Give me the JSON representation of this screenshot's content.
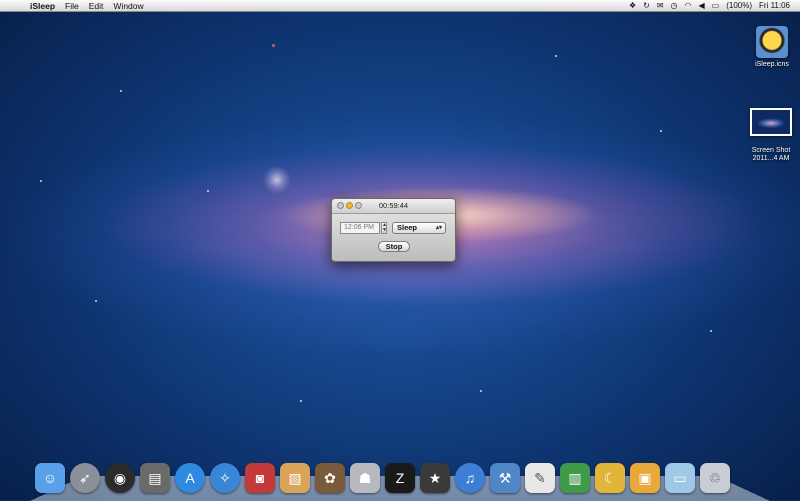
{
  "menubar": {
    "apple_glyph": "",
    "app_name": "iSleep",
    "items": [
      "File",
      "Edit",
      "Window"
    ],
    "battery": "(100%)",
    "clock": "Fri 11:06"
  },
  "desktop_icons": [
    {
      "label": "iSleep.icns"
    },
    {
      "label": "Screen Shot\n2011...4 AM"
    }
  ],
  "window": {
    "title": "00:59:44",
    "time_value": "12:06 PM",
    "action_selected": "Sleep",
    "stop_label": "Stop"
  },
  "dock": {
    "items": [
      {
        "name": "finder-icon",
        "color": "#5aa0e8"
      },
      {
        "name": "launchpad-icon",
        "color": "#8a8f98"
      },
      {
        "name": "dashboard-icon",
        "color": "#2b2b2b"
      },
      {
        "name": "mission-control-icon",
        "color": "#6a6a6a"
      },
      {
        "name": "app-store-icon",
        "color": "#2d8ae0"
      },
      {
        "name": "safari-icon",
        "color": "#3a86d6"
      },
      {
        "name": "photo-booth-icon",
        "color": "#c43a3a"
      },
      {
        "name": "preview-icon",
        "color": "#d9a45a"
      },
      {
        "name": "iphoto-icon",
        "color": "#7a5a3a"
      },
      {
        "name": "automator-icon",
        "color": "#b8b8c0"
      },
      {
        "name": "app-icon-blue",
        "color": "#1a1a1a"
      },
      {
        "name": "imovie-icon",
        "color": "#3a3a3a"
      },
      {
        "name": "itunes-icon",
        "color": "#3d7fd6"
      },
      {
        "name": "xcode-icon",
        "color": "#4f86c6"
      },
      {
        "name": "textedit-icon",
        "color": "#e8e8e8"
      },
      {
        "name": "numbers-icon",
        "color": "#3f9a4a"
      },
      {
        "name": "isleep-icon",
        "color": "#e2b43a"
      },
      {
        "name": "applications-folder-icon",
        "color": "#e8a83a"
      },
      {
        "name": "downloads-folder-icon",
        "color": "#9fc7e6"
      },
      {
        "name": "trash-icon",
        "color": "#c8cdd4"
      }
    ]
  }
}
